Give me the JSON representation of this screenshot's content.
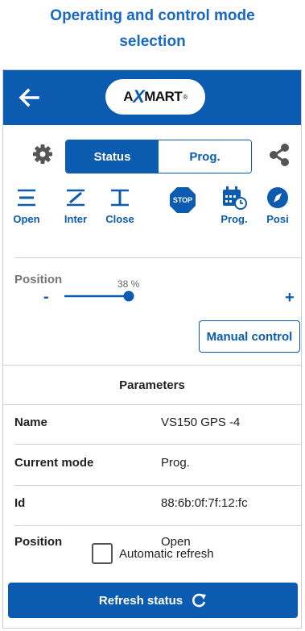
{
  "heading": {
    "line1": "Operating and control mode",
    "line2": "selection"
  },
  "topbar": {
    "back_icon": "arrow-left-icon",
    "logo_pre": "A",
    "logo_x": "X",
    "logo_post": "MART",
    "logo_reg": "®",
    "color": "#0b5bb0"
  },
  "toolbar": {
    "settings_icon": "gear-icon",
    "share_icon": "share-icon",
    "tabs": [
      {
        "label": "Status",
        "active": true
      },
      {
        "label": "Prog.",
        "active": false
      }
    ]
  },
  "modes": [
    {
      "label": "Open",
      "icon": "valve-open-icon"
    },
    {
      "label": "Inter",
      "icon": "valve-inter-icon"
    },
    {
      "label": "Close",
      "icon": "valve-close-icon"
    },
    {
      "label": "",
      "icon": "stop-icon",
      "badge": "STOP"
    },
    {
      "label": "Prog.",
      "icon": "calendar-clock-icon"
    },
    {
      "label": "Posi",
      "icon": "compass-icon"
    }
  ],
  "position": {
    "label": "Position",
    "percent_text": "38 %",
    "value": 0.38,
    "minus": "-",
    "plus": "+"
  },
  "manual_control": {
    "label": "Manual control"
  },
  "parameters": {
    "title": "Parameters",
    "rows": [
      {
        "key": "Name",
        "value": "VS150 GPS -4"
      },
      {
        "key": "Current mode",
        "value": "Prog."
      },
      {
        "key": "Id",
        "value": "88:6b:0f:7f:12:fc"
      },
      {
        "key": "Position",
        "value": "Open"
      }
    ]
  },
  "auto_refresh": {
    "label": "Automatic refresh",
    "checked": false
  },
  "refresh_button": {
    "label": "Refresh status",
    "icon": "refresh-icon"
  }
}
